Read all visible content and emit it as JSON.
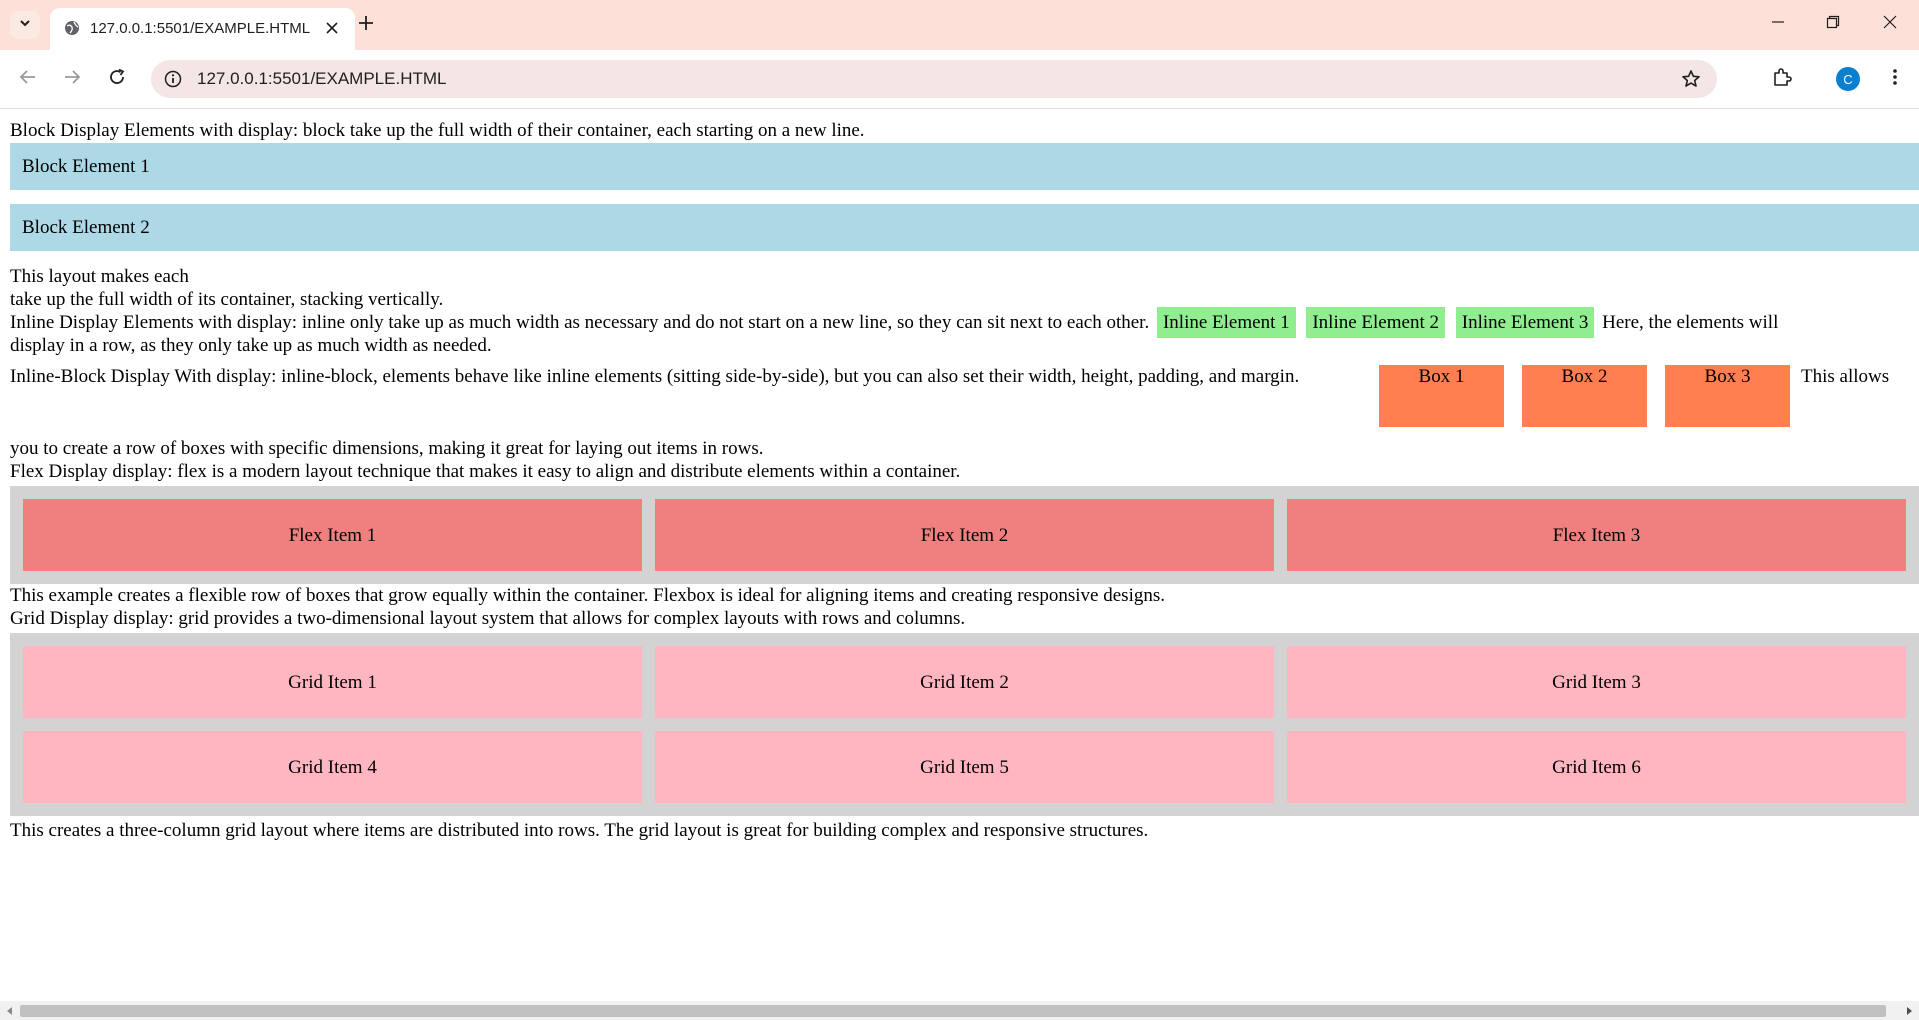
{
  "browser": {
    "tab_title": "127.0.0.1:5501/EXAMPLE.HTML",
    "url": "127.0.0.1:5501/EXAMPLE.HTML",
    "profile_initial": "C",
    "icons": [
      "tab-search-icon",
      "globe-icon",
      "close-icon",
      "plus-icon",
      "minimize-icon",
      "restore-icon",
      "close-window-icon",
      "back-icon",
      "forward-icon",
      "reload-icon",
      "site-info-icon",
      "star-icon",
      "extensions-icon",
      "kebab-menu-icon"
    ]
  },
  "colors": {
    "block": "#add8e6",
    "inline": "#90ee90",
    "inline_block": "#ff7f50",
    "flex_item": "#f08080",
    "grid_item": "#ffb6c1",
    "container": "#d3d3d3"
  },
  "page": {
    "block_intro": "Block Display Elements with display: block take up the full width of their container, each starting on a new line.",
    "block_items": [
      "Block Element 1",
      "Block Element 2"
    ],
    "block_outro_1": "This layout makes each",
    "block_outro_2": "take up the full width of its container, stacking vertically.",
    "inline_intro": "Inline Display Elements with display: inline only take up as much width as necessary and do not start on a new line, so they can sit next to each other.",
    "inline_items": [
      "Inline Element 1",
      "Inline Element 2",
      "Inline Element 3"
    ],
    "inline_outro_1": "Here, the elements will",
    "inline_outro_2": "display in a row, as they only take up as much width as needed.",
    "ib_intro": "Inline-Block Display With display: inline-block, elements behave like inline elements (sitting side-by-side), but you can also set their width, height, padding, and margin.",
    "ib_items": [
      "Box 1",
      "Box 2",
      "Box 3"
    ],
    "ib_outro_1": "This allows",
    "ib_outro_2": "you to create a row of boxes with specific dimensions, making it great for laying out items in rows.",
    "flex_intro": "Flex Display display: flex is a modern layout technique that makes it easy to align and distribute elements within a container.",
    "flex_items": [
      "Flex Item 1",
      "Flex Item 2",
      "Flex Item 3"
    ],
    "flex_outro": "This example creates a flexible row of boxes that grow equally within the container. Flexbox is ideal for aligning items and creating responsive designs.",
    "grid_intro": "Grid Display display: grid provides a two-dimensional layout system that allows for complex layouts with rows and columns.",
    "grid_items": [
      "Grid Item 1",
      "Grid Item 2",
      "Grid Item 3",
      "Grid Item 4",
      "Grid Item 5",
      "Grid Item 6"
    ],
    "grid_outro": "This creates a three-column grid layout where items are distributed into rows. The grid layout is great for building complex and responsive structures."
  }
}
